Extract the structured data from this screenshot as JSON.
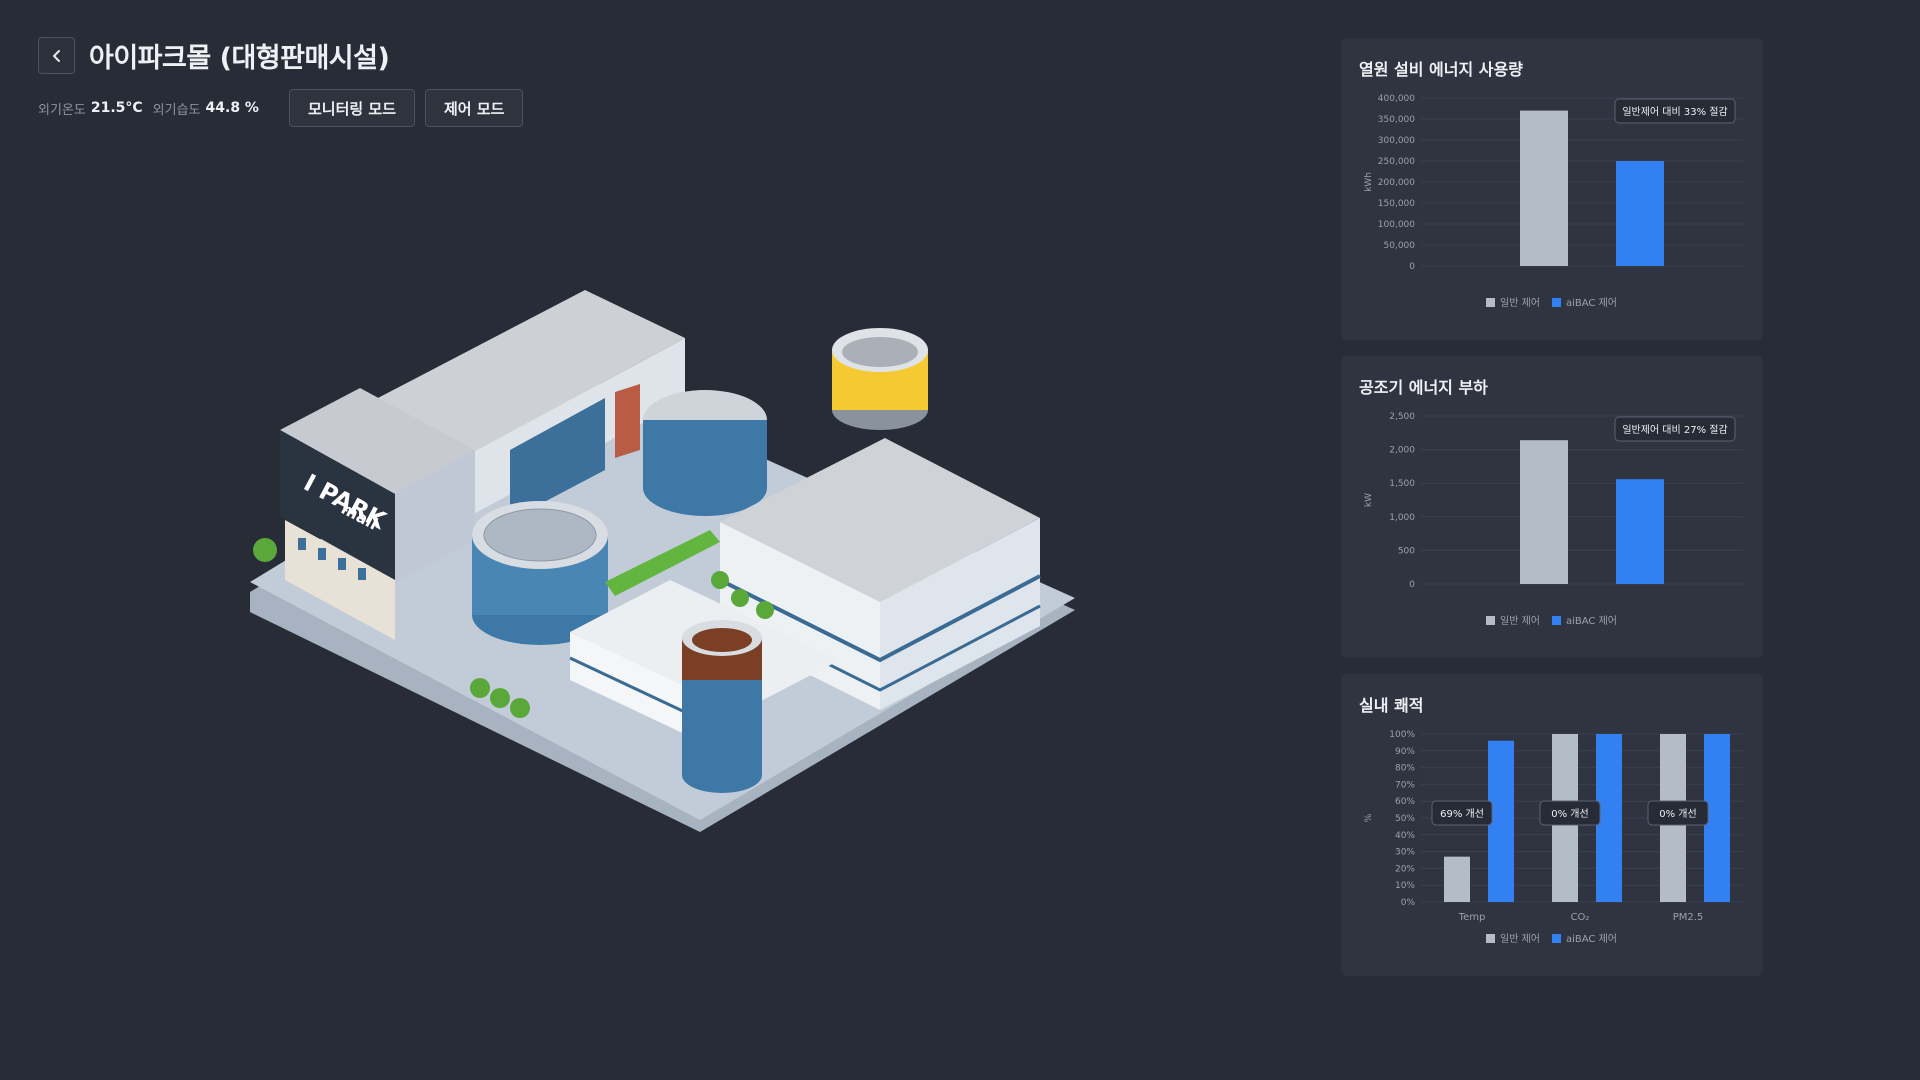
{
  "header": {
    "title": "아이파크몰 (대형판매시설)",
    "outdoor_temp_label": "외기온도",
    "outdoor_temp_value": "21.5°C",
    "outdoor_humidity_label": "외기습도",
    "outdoor_humidity_value": "44.8 %",
    "monitoring_mode_label": "모니터링 모드",
    "control_mode_label": "제어 모드"
  },
  "building": {
    "sign_text": "I PARK",
    "sign_sub": "mall"
  },
  "colors": {
    "background": "#272c37",
    "panel": "#2f3440",
    "normal": "#b4bcc6",
    "aibac": "#3380f2"
  },
  "charts": [
    {
      "title": "열원 설비 에너지 사용량",
      "chart_data": {
        "type": "bar",
        "categories": [
          "일반 제어",
          "aiBAC 제어"
        ],
        "values": [
          370000,
          250000
        ],
        "ylabel": "kWh",
        "ylim": [
          0,
          400000
        ],
        "yticks": [
          "400,000",
          "350,000",
          "300,000",
          "250,000",
          "200,000",
          "150,000",
          "100,000",
          "50,000",
          "0"
        ],
        "annotation": "일반제어 대비 33% 절감",
        "legend": [
          "일반 제어",
          "aiBAC 제어"
        ],
        "legend_position": "bottom"
      }
    },
    {
      "title": "공조기 에너지 부하",
      "chart_data": {
        "type": "bar",
        "categories": [
          "일반 제어",
          "aiBAC 제어"
        ],
        "values": [
          2140,
          1560
        ],
        "ylabel": "kW",
        "ylim": [
          0,
          2500
        ],
        "yticks": [
          "2,500",
          "2,000",
          "1,500",
          "1,000",
          "500",
          "0"
        ],
        "annotation": "일반제어 대비 27% 절감",
        "legend": [
          "일반 제어",
          "aiBAC 제어"
        ],
        "legend_position": "bottom"
      }
    },
    {
      "title": "실내 쾌적",
      "chart_data": {
        "type": "bar",
        "categories": [
          "Temp",
          "CO₂",
          "PM2.5"
        ],
        "series": [
          {
            "name": "일반 제어",
            "values": [
              27,
              100,
              100
            ]
          },
          {
            "name": "aiBAC 제어",
            "values": [
              96,
              100,
              100
            ]
          }
        ],
        "ylabel": "%",
        "ylim": [
          0,
          100
        ],
        "yticks": [
          "100%",
          "90%",
          "80%",
          "70%",
          "60%",
          "50%",
          "40%",
          "30%",
          "20%",
          "10%",
          "0%"
        ],
        "annotations": [
          "69% 개선",
          "0% 개선",
          "0% 개선"
        ],
        "legend": [
          "일반 제어",
          "aiBAC 제어"
        ],
        "legend_position": "bottom"
      }
    }
  ]
}
